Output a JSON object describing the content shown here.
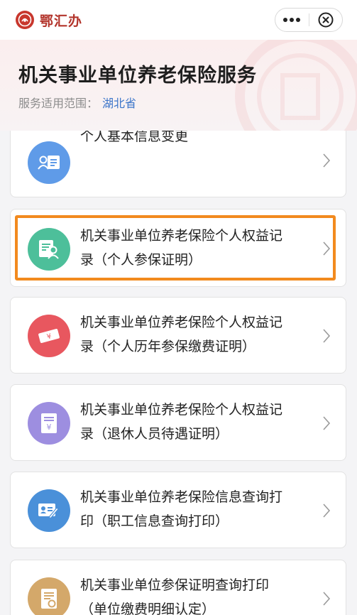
{
  "app": {
    "name": "鄂汇办",
    "brand_color": "#b3352c"
  },
  "navbar": {
    "more_icon": "more-dots-icon",
    "close_icon": "close-circle-icon"
  },
  "header": {
    "title": "机关事业单位养老保险服务",
    "scope_label": "服务适用范围：",
    "scope_value": "湖北省"
  },
  "services": [
    {
      "line1": "个人基本信息变更",
      "line2": "",
      "icon": "person-id-card-icon",
      "icon_color": "#5f9be8"
    },
    {
      "line1": "机关事业单位养老保险个人权益记",
      "line2": "录（个人参保证明）",
      "icon": "certificate-person-icon",
      "icon_color": "#4dbf9a",
      "highlighted": true
    },
    {
      "line1": "机关事业单位养老保险个人权益记",
      "line2": "录（个人历年参保缴费证明）",
      "icon": "money-bill-icon",
      "icon_color": "#e8575f"
    },
    {
      "line1": "机关事业单位养老保险个人权益记",
      "line2": "录（退休人员待遇证明）",
      "icon": "yuan-document-icon",
      "icon_color": "#9d8ee0"
    },
    {
      "line1": "机关事业单位养老保险信息查询打",
      "line2": "印（职工信息查询打印）",
      "icon": "id-card-pen-icon",
      "icon_color": "#4a90d9"
    },
    {
      "line1": "机关事业单位参保证明查询打印",
      "line2": "（单位缴费明细认定）",
      "icon": "stamped-document-icon",
      "icon_color": "#d4a86a"
    }
  ],
  "colors": {
    "highlight_border": "#f28a1e",
    "scope_link": "#3a74c9"
  }
}
